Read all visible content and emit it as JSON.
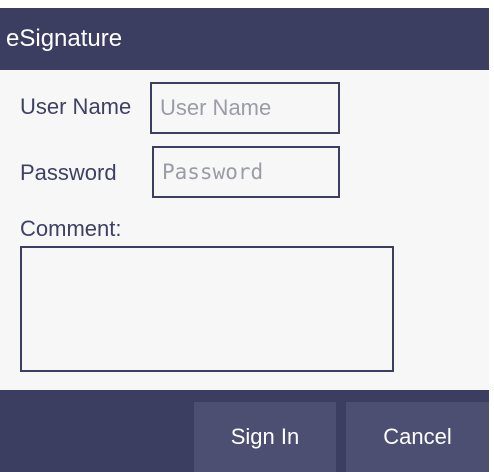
{
  "dialog": {
    "title": "eSignature"
  },
  "form": {
    "username_label": "User Name",
    "username_placeholder": "User Name",
    "username_value": "",
    "password_label": "Password",
    "password_placeholder": "Password",
    "password_value": "",
    "comment_label": "Comment:",
    "comment_value": ""
  },
  "buttons": {
    "signin_label": "Sign In",
    "cancel_label": "Cancel"
  },
  "colors": {
    "header_bg": "#3b3e61",
    "button_bg": "#4d4f72",
    "text": "#3e4162",
    "dialog_bg": "#f7f7f7"
  }
}
